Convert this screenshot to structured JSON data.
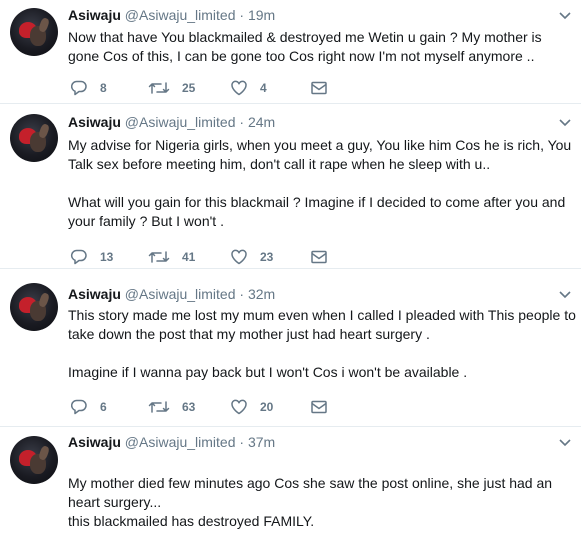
{
  "tweets": [
    {
      "name": "Asiwaju",
      "handle": "@Asiwaju_limited",
      "time": "19m",
      "paragraphs": [
        "Now that have You blackmailed &  destroyed  me Wetin u gain ? My mother is gone Cos of this, I can be gone too Cos right now I'm not myself anymore .."
      ],
      "replies": "8",
      "retweets": "25",
      "likes": "4"
    },
    {
      "name": "Asiwaju",
      "handle": "@Asiwaju_limited",
      "time": "24m",
      "paragraphs": [
        "My advise for Nigeria girls, when you meet a guy, You like him Cos he is rich, You Talk sex before meeting him, don't call it rape when he sleep with u..",
        "What will you gain for this blackmail ? Imagine if I decided to come after you and your family ? But I won't ."
      ],
      "replies": "13",
      "retweets": "41",
      "likes": "23"
    },
    {
      "name": "Asiwaju",
      "handle": "@Asiwaju_limited",
      "time": "32m",
      "paragraphs": [
        "This story made me lost my mum even when I called I pleaded with This people to take down the post that my mother just had heart surgery .",
        "Imagine if I wanna pay back but I won't Cos i won't be available ."
      ],
      "replies": "6",
      "retweets": "63",
      "likes": "20"
    },
    {
      "name": "Asiwaju",
      "handle": "@Asiwaju_limited",
      "time": "37m",
      "paragraphs": [
        "My mother died few minutes ago Cos she saw the post online, she just had an heart surgery...\nthis blackmailed has destroyed FAMILY."
      ],
      "replies": "",
      "retweets": "",
      "likes": ""
    }
  ],
  "icons": {
    "reply": "reply-icon",
    "retweet": "retweet-icon",
    "like": "heart-icon",
    "dm": "envelope-icon",
    "caret": "chevron-down-icon"
  },
  "colors": {
    "text": "#14171a",
    "secondary": "#657786",
    "divider": "#e6ecf0"
  }
}
